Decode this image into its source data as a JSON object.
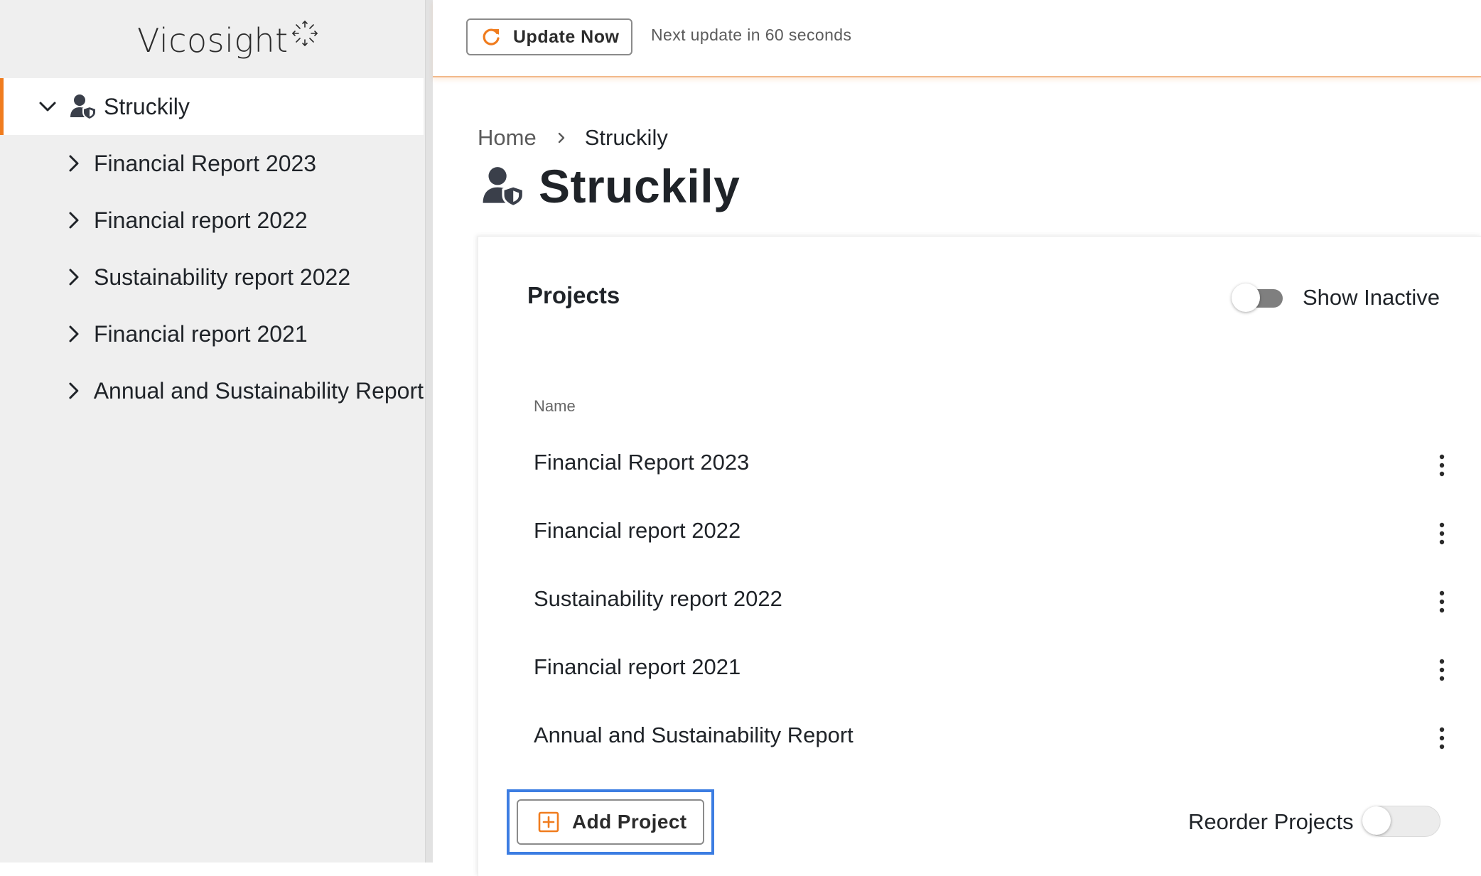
{
  "app": {
    "logo_text": "Vicosight"
  },
  "topbar": {
    "update_label": "Update Now",
    "next_update_text": "Next update in 60 seconds"
  },
  "sidebar": {
    "root": {
      "label": "Struckily",
      "icon": "user-shield-icon",
      "expanded": true
    },
    "items": [
      {
        "label": "Financial Report 2023"
      },
      {
        "label": "Financial report 2022"
      },
      {
        "label": "Sustainability report 2022"
      },
      {
        "label": "Financial report 2021"
      },
      {
        "label": "Annual and Sustainability Report"
      }
    ]
  },
  "breadcrumb": {
    "home": "Home",
    "current": "Struckily"
  },
  "page": {
    "title": "Struckily",
    "title_icon": "user-shield-icon"
  },
  "projects": {
    "title": "Projects",
    "show_inactive_label": "Show Inactive",
    "show_inactive_on": false,
    "column_name": "Name",
    "rows": [
      {
        "name": "Financial Report 2023"
      },
      {
        "name": "Financial report 2022"
      },
      {
        "name": "Sustainability report 2022"
      },
      {
        "name": "Financial report 2021"
      },
      {
        "name": "Annual and Sustainability Report"
      }
    ],
    "add_label": "Add Project",
    "reorder_label": "Reorder Projects",
    "reorder_on": false
  },
  "colors": {
    "accent": "#f07c1e",
    "focus": "#3c7de2",
    "icon": "#3a3f4a"
  }
}
